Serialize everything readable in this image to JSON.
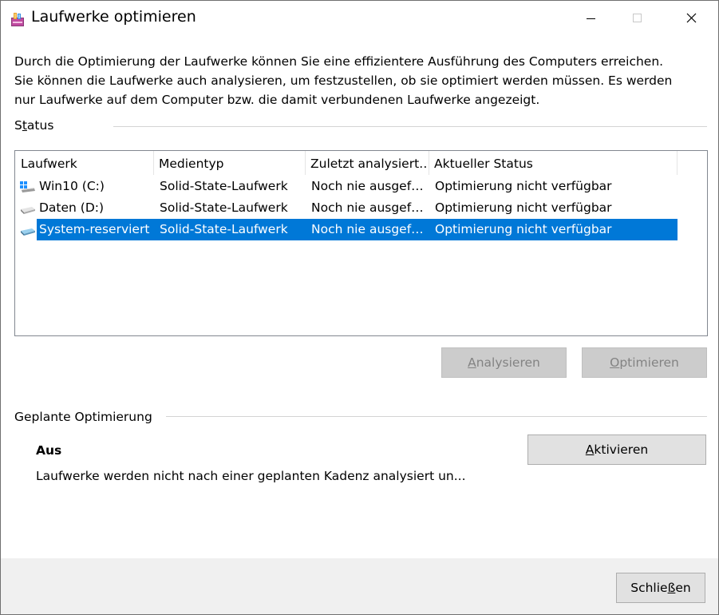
{
  "window": {
    "title": "Laufwerke optimieren"
  },
  "intro": {
    "line1": "Durch die Optimierung der Laufwerke können Sie eine effizientere Ausführung des Computers erreichen.",
    "line2": "Sie können die Laufwerke auch analysieren, um festzustellen, ob sie optimiert werden müssen. Es werden",
    "line3": "nur Laufwerke auf dem Computer bzw. die damit verbundenen Laufwerke angezeigt."
  },
  "status_group": {
    "label_pre": "S",
    "label_mn": "t",
    "label_post": "atus",
    "columns": [
      "Laufwerk",
      "Medientyp",
      "Zuletzt analysiert…",
      "Aktueller Status"
    ],
    "rows": [
      {
        "drive": "Win10 (C:)",
        "media": "Solid-State-Laufwerk",
        "last": "Noch nie ausgef…",
        "status": "Optimierung nicht verfügbar",
        "icon": "windows-drive-icon",
        "selected": false
      },
      {
        "drive": "Daten (D:)",
        "media": "Solid-State-Laufwerk",
        "last": "Noch nie ausgef…",
        "status": "Optimierung nicht verfügbar",
        "icon": "drive-icon",
        "selected": false
      },
      {
        "drive": "System-reserviert",
        "media": "Solid-State-Laufwerk",
        "last": "Noch nie ausgef…",
        "status": "Optimierung nicht verfügbar",
        "icon": "drive-icon",
        "selected": true
      }
    ]
  },
  "buttons": {
    "analyze": {
      "mn": "A",
      "rest": "nalysieren",
      "enabled": false
    },
    "optimize": {
      "mn": "O",
      "rest": "ptimieren",
      "enabled": false
    }
  },
  "schedule": {
    "label": "Geplante Optimierung",
    "status": "Aus",
    "description": "Laufwerke werden nicht nach einer geplanten Kadenz analysiert un...",
    "activate": {
      "mn": "A",
      "rest": "ktivieren"
    }
  },
  "footer": {
    "close": {
      "pre": "Schlie",
      "mn": "ß",
      "rest": "en"
    }
  },
  "colors": {
    "selection": "#0078d7",
    "footer_bg": "#f0f0f0",
    "button_bg": "#e1e1e1",
    "button_disabled_bg": "#cccccc"
  }
}
